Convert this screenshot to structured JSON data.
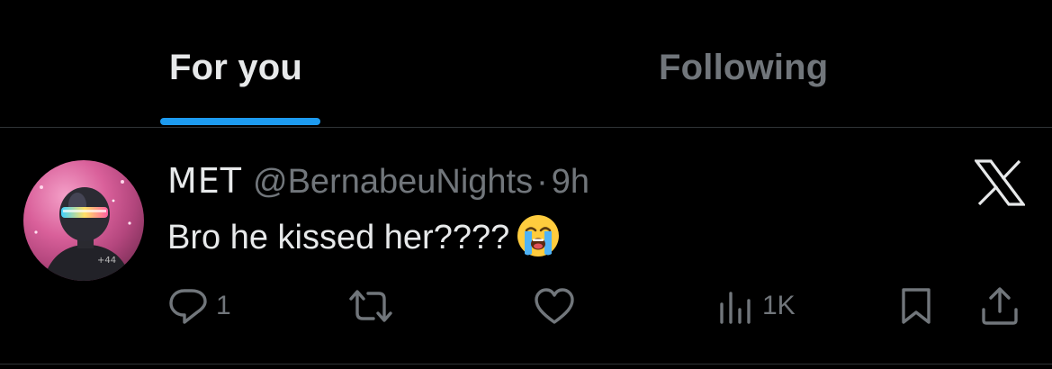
{
  "tabs": [
    {
      "label": "For you",
      "active": true
    },
    {
      "label": "Following",
      "active": false
    }
  ],
  "post": {
    "display_name": "MET",
    "handle": "@BernabeuNights",
    "separator": "·",
    "time": "9h",
    "text": "Bro he kissed her????",
    "emoji": "loudly-crying-face",
    "reply_count": "1",
    "view_count": "1K"
  },
  "icons": {
    "reply": "reply-icon",
    "repost": "repost-icon",
    "like": "heart-icon",
    "views": "analytics-icon",
    "bookmark": "bookmark-icon",
    "share": "share-icon",
    "brand": "x-logo-icon"
  },
  "colors": {
    "background": "#000000",
    "text_primary": "#e7e9ea",
    "text_secondary": "#71767b",
    "accent": "#1d9bf0",
    "divider": "#2f3336"
  }
}
